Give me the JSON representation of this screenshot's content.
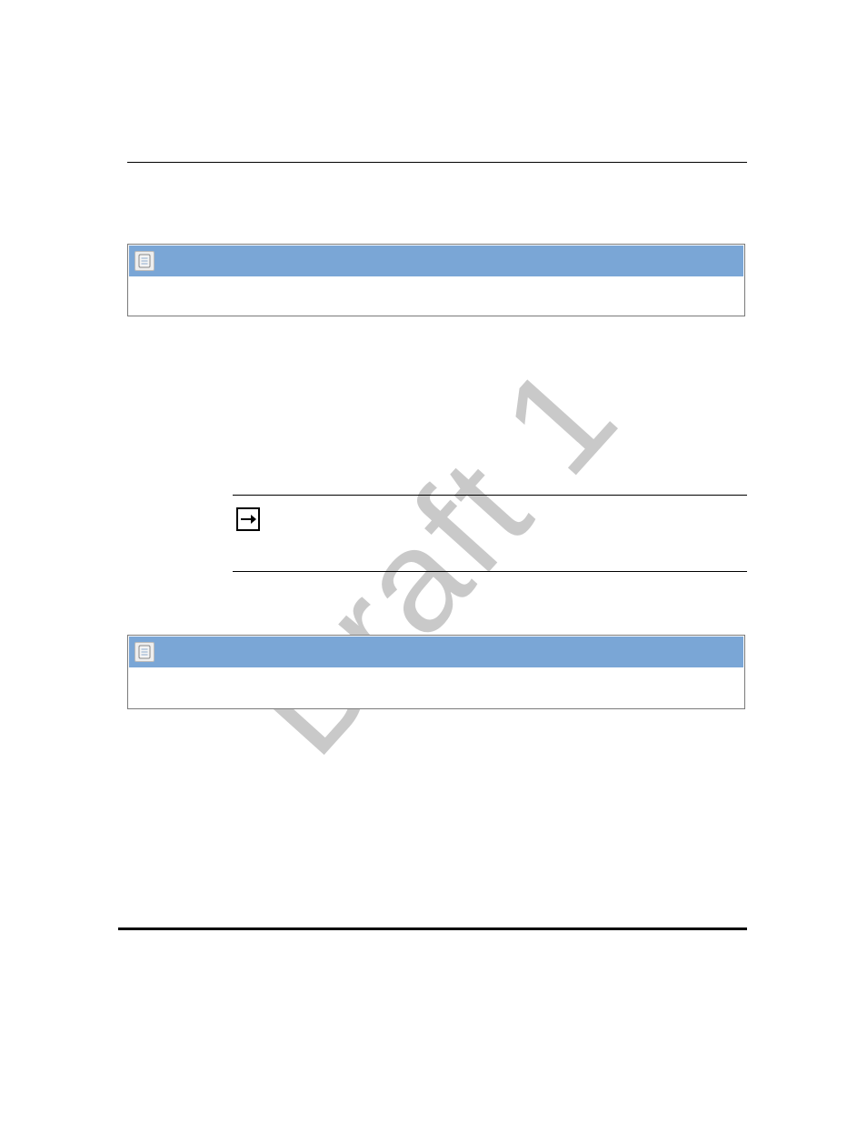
{
  "watermark": "Draft 1",
  "notes": [
    {
      "icon": "note-icon"
    },
    {
      "icon": "note-icon"
    }
  ],
  "arrow": "arrow-right-icon"
}
